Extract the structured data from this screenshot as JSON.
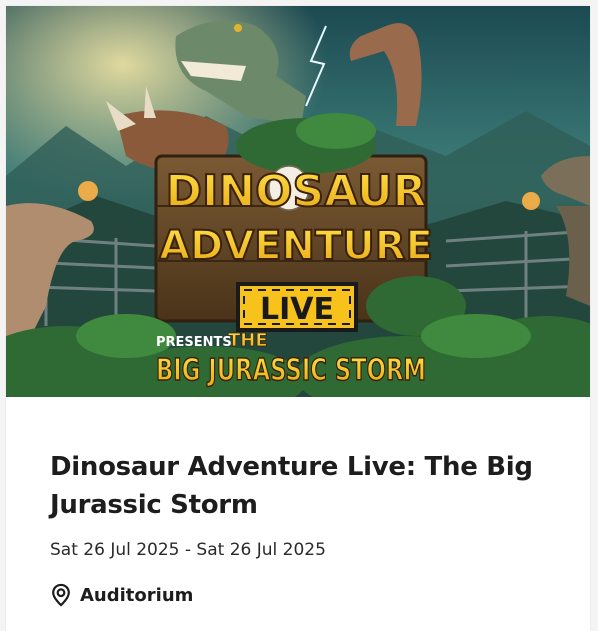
{
  "event": {
    "poster": {
      "title_line1": "DINOSAUR",
      "title_line2": "ADVENTURE",
      "badge": "LIVE",
      "presents": "PRESENTS",
      "the": "THE",
      "subtitle": "BIG JURASSIC STORM"
    },
    "title": "Dinosaur Adventure Live: The Big Jurassic Storm",
    "dates": "Sat 26 Jul 2025 - Sat 26 Jul 2025",
    "venue": "Auditorium",
    "venue_icon": "location-pin-icon"
  }
}
